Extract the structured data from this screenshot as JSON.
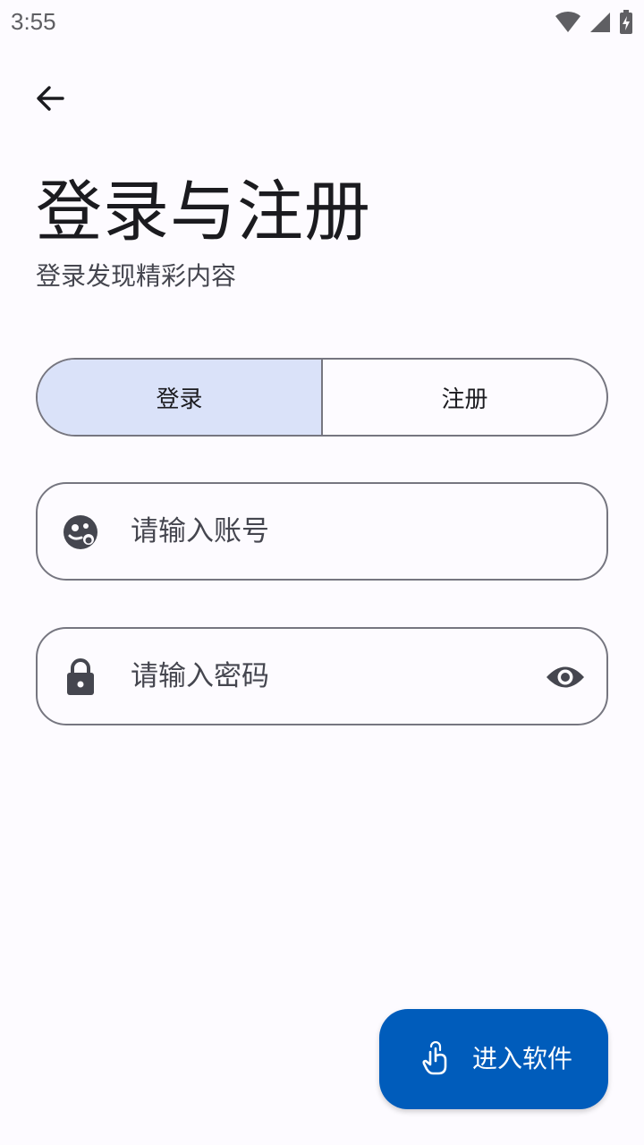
{
  "status_bar": {
    "time": "3:55",
    "icons": [
      "wifi-icon",
      "cellular-signal-icon",
      "battery-charging-icon"
    ]
  },
  "header": {
    "back_icon": "arrow-back-icon",
    "title": "登录与注册",
    "subtitle": "登录发现精彩内容"
  },
  "mode_toggle": {
    "selected": "登录",
    "options": [
      "登录",
      "注册"
    ]
  },
  "form": {
    "account": {
      "icon": "account-avatar-icon",
      "placeholder": "请输入账号",
      "value": ""
    },
    "password": {
      "icon": "lock-icon",
      "placeholder": "请输入密码",
      "value": "",
      "toggle_icon": "eye-visibility-icon"
    }
  },
  "fab": {
    "icon": "touch-hand-icon",
    "label": "进入软件"
  },
  "colors": {
    "background": "#fdfbff",
    "primary": "#005cbb",
    "segment_active": "#dae2f9",
    "outline": "#767680",
    "icon": "#45464f"
  }
}
